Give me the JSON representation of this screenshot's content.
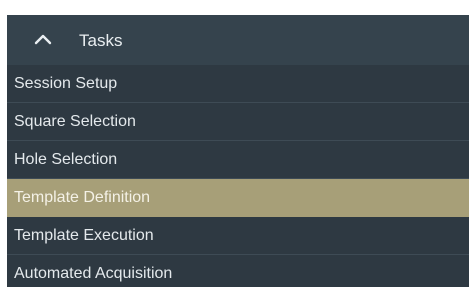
{
  "panel": {
    "title": "Tasks",
    "collapse_icon": "chevron-up-icon",
    "colors": {
      "header_bg": "#35434d",
      "list_bg": "#2e3942",
      "selected_bg": "#a79f78"
    }
  },
  "tasks": {
    "items": [
      {
        "label": "Session Setup",
        "selected": false
      },
      {
        "label": "Square Selection",
        "selected": false
      },
      {
        "label": "Hole Selection",
        "selected": false
      },
      {
        "label": "Template Definition",
        "selected": true
      },
      {
        "label": "Template Execution",
        "selected": false
      },
      {
        "label": "Automated Acquisition",
        "selected": false
      }
    ]
  }
}
